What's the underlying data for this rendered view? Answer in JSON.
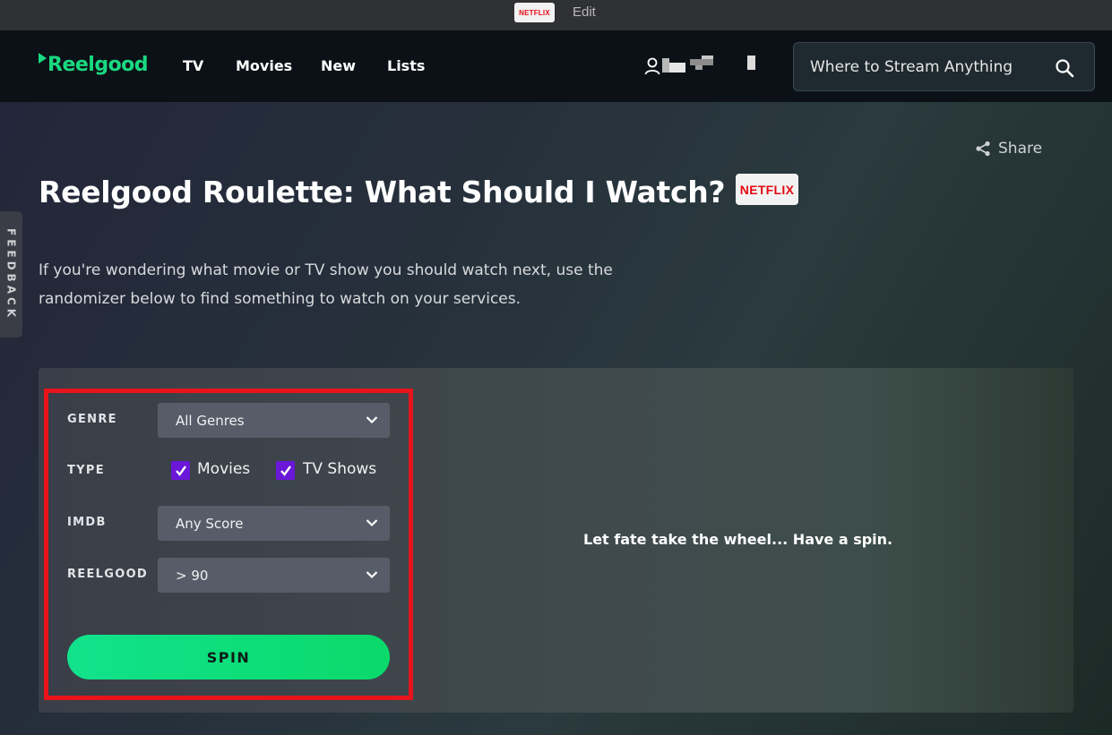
{
  "edit_bar": {
    "badge_text": "NETFLIX",
    "edit_label": "Edit"
  },
  "header": {
    "logo_text": "Reelgood",
    "nav": [
      {
        "label": "TV"
      },
      {
        "label": "Movies"
      },
      {
        "label": "New"
      },
      {
        "label": "Lists"
      }
    ],
    "search": {
      "placeholder": "Where to Stream Anything"
    }
  },
  "page": {
    "share_label": "Share",
    "feedback_label": "FEEDBACK",
    "title": "Reelgood Roulette: What Should I Watch?",
    "title_badge": "NETFLIX",
    "intro": "If you're wondering what movie or TV show you should watch next, use the randomizer below to find something to watch on your services."
  },
  "roulette": {
    "genre": {
      "label": "GENRE",
      "value": "All Genres"
    },
    "type": {
      "label": "TYPE",
      "options": [
        {
          "label": "Movies",
          "checked": true
        },
        {
          "label": "TV Shows",
          "checked": true
        }
      ]
    },
    "imdb": {
      "label": "IMDB",
      "value": "Any Score"
    },
    "reelgood": {
      "label": "REELGOOD",
      "value": "> 90"
    },
    "spin_label": "SPIN",
    "result_text": "Let fate take the wheel... Have a spin."
  },
  "colors": {
    "brand_green": "#19d980",
    "checkbox_purple": "#6a17d8",
    "highlight_red": "#e8141b",
    "netflix_red": "#e50914"
  }
}
